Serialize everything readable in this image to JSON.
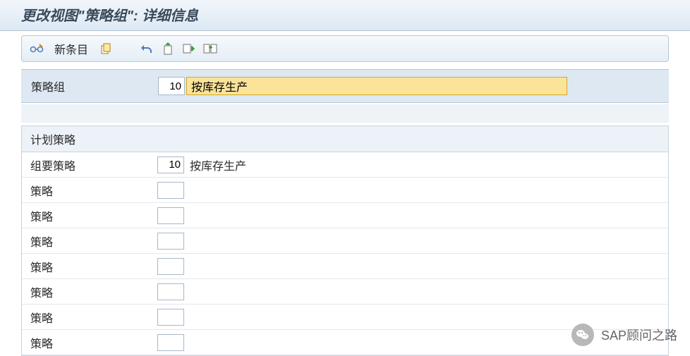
{
  "title": "更改视图\"策略组\": 详细信息",
  "toolbar": {
    "new_entry_label": "新条目"
  },
  "header": {
    "label": "策略组",
    "code": "10",
    "description": "按库存生产"
  },
  "section": {
    "title": "计划策略",
    "rows": [
      {
        "label": "组要策略",
        "code": "10",
        "description": "按库存生产"
      },
      {
        "label": "策略",
        "code": "",
        "description": ""
      },
      {
        "label": "策略",
        "code": "",
        "description": ""
      },
      {
        "label": "策略",
        "code": "",
        "description": ""
      },
      {
        "label": "策略",
        "code": "",
        "description": ""
      },
      {
        "label": "策略",
        "code": "",
        "description": ""
      },
      {
        "label": "策略",
        "code": "",
        "description": ""
      },
      {
        "label": "策略",
        "code": "",
        "description": ""
      }
    ]
  },
  "watermark": "SAP顾问之路"
}
